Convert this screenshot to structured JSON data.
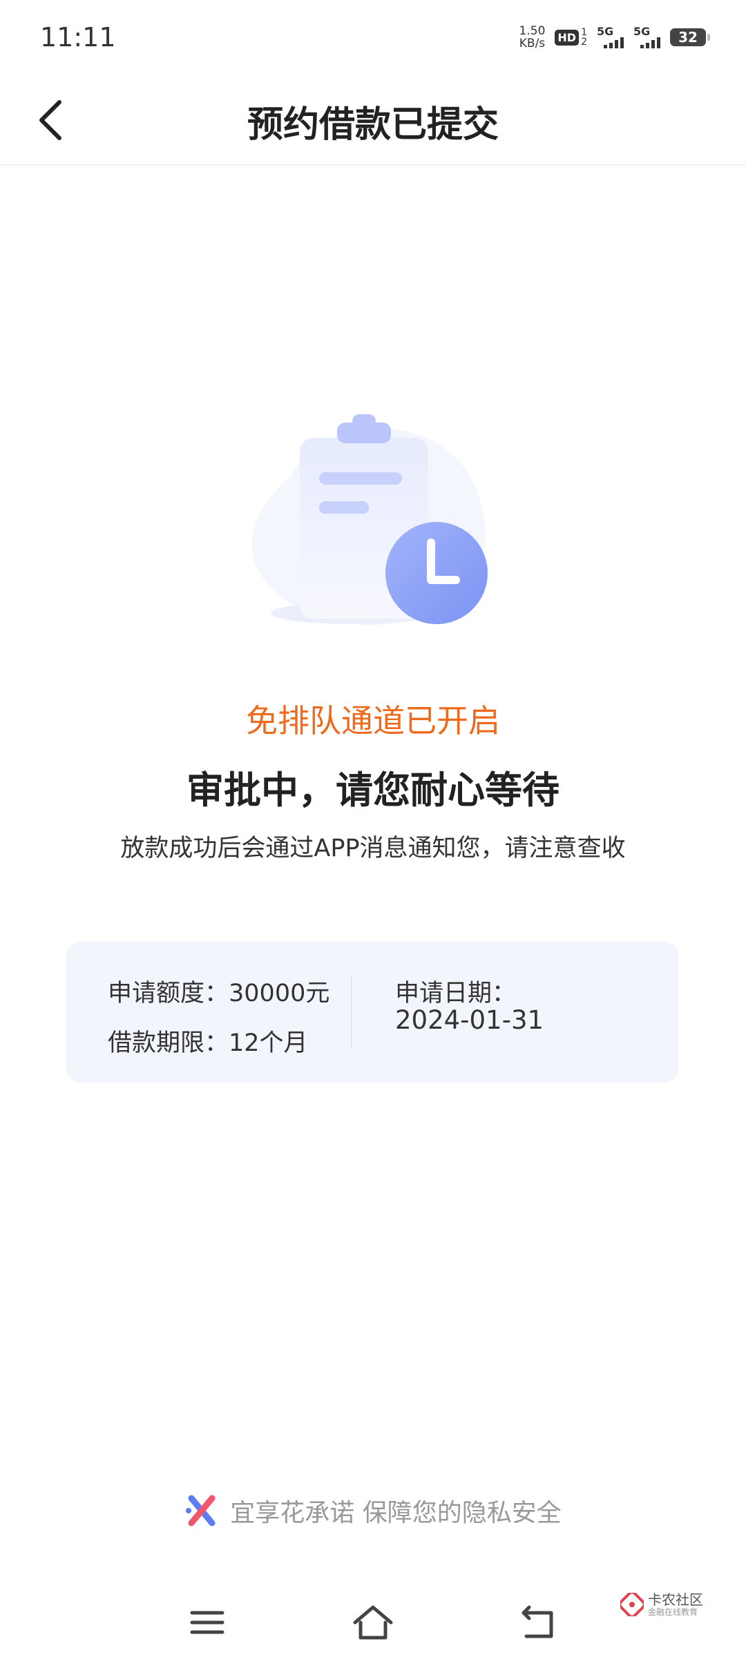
{
  "status_bar": {
    "time": "11:11",
    "net_speed_value": "1.50",
    "net_speed_unit": "KB/s",
    "hd_label": "HD",
    "hd_sub_top": "1",
    "hd_sub_bottom": "2",
    "signal1_label": "5G",
    "signal2_label": "5G",
    "battery": "32"
  },
  "header": {
    "title": "预约借款已提交"
  },
  "status": {
    "fast_lane": "免排队通道已开启",
    "approving": "审批中，请您耐心等待",
    "notice": "放款成功后会通过APP消息通知您，请注意查收"
  },
  "info": {
    "amount_label": "申请额度：",
    "amount_value": "30000元",
    "term_label": "借款期限：",
    "term_value": "12个月",
    "date_label": "申请日期：",
    "date_value": "2024-01-31"
  },
  "footer": {
    "promise": "宜享花承诺 保障您的隐私安全"
  },
  "watermark": {
    "title": "卡农社区",
    "subtitle": "金融在线教育"
  },
  "colors": {
    "accent_orange": "#ee6a1d",
    "card_bg": "#f3f5fd",
    "clock_blue": "#8aa0f7"
  }
}
